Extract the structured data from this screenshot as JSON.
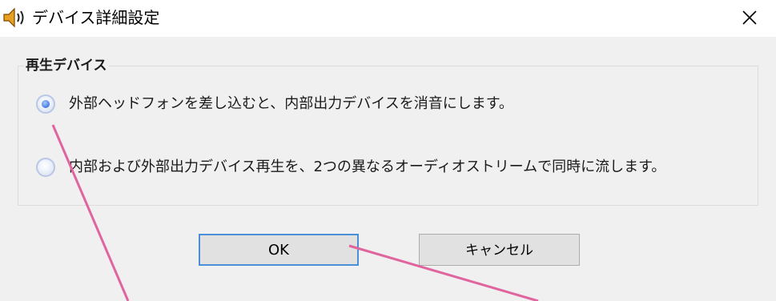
{
  "window": {
    "title": "デバイス詳細設定",
    "icon": "speaker-icon",
    "close_icon": "close-icon"
  },
  "group": {
    "label": "再生デバイス",
    "options": [
      {
        "label": "外部ヘッドフォンを差し込むと、内部出力デバイスを消音にします。",
        "selected": true
      },
      {
        "label": "内部および外部出力デバイス再生を、2つの異なるオーディオストリームで同時に流します。",
        "selected": false
      }
    ]
  },
  "buttons": {
    "ok": "OK",
    "cancel": "キャンセル"
  },
  "colors": {
    "annotation_line": "#e0649e",
    "focus_border": "#4a90d9",
    "dialog_body": "#f0f0f0"
  }
}
